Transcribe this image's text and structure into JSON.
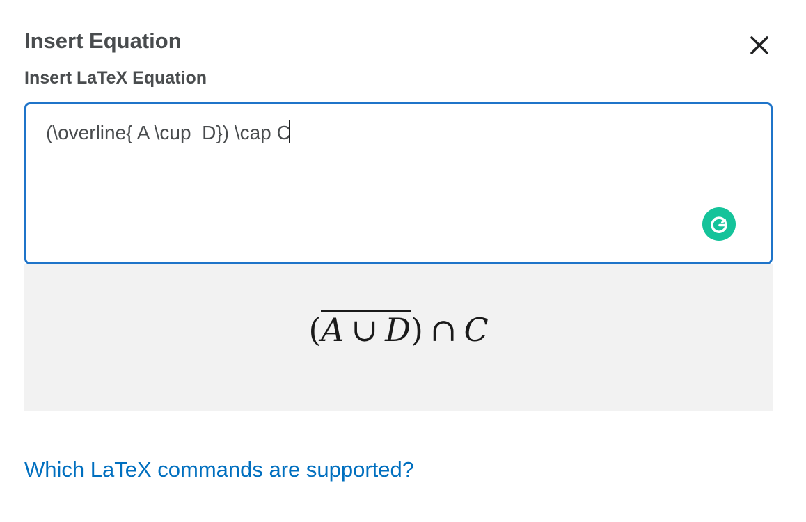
{
  "dialog": {
    "title": "Insert Equation",
    "close_icon": "close-icon"
  },
  "editor": {
    "label": "Insert LaTeX Equation",
    "value": "(\\overline{ A \\cup  D}) \\cap C",
    "grammarly_icon": "grammarly-icon"
  },
  "preview": {
    "open_paren": "(",
    "var_a": "A",
    "cup": "∪",
    "var_d": "D",
    "close_paren": ")",
    "cap": "∩",
    "var_c": "C"
  },
  "help": {
    "link_text": "Which LaTeX commands are supported?"
  },
  "colors": {
    "accent": "#1f74c9",
    "link": "#006fbf",
    "grammarly": "#15c39a",
    "preview_bg": "#f2f2f2",
    "text": "#494c4e"
  }
}
